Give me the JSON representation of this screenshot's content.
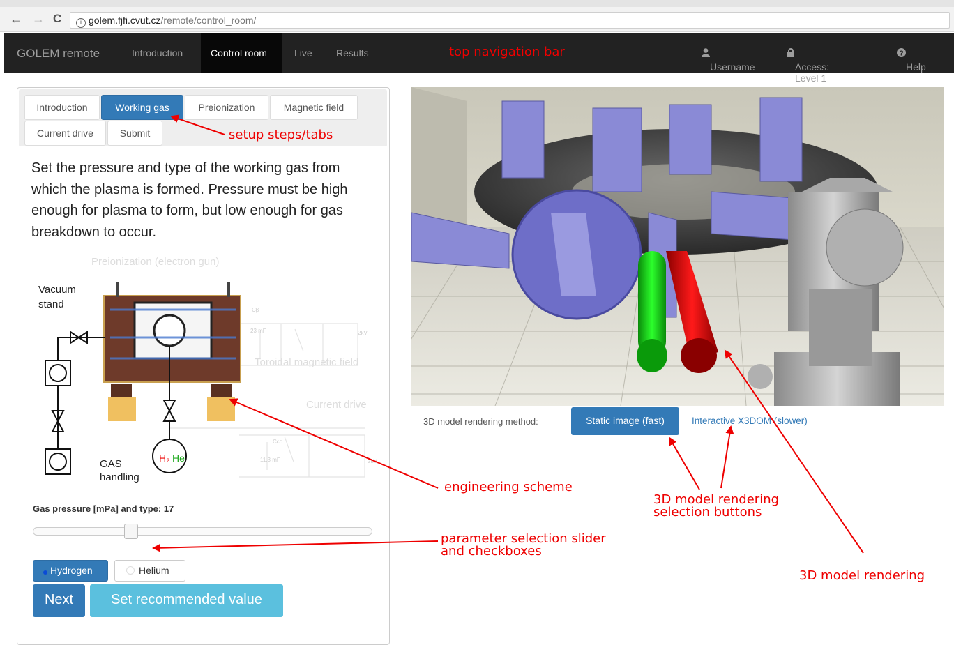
{
  "browser": {
    "back_glyph": "←",
    "forward_glyph": "→",
    "reload_glyph": "C",
    "url_host": "golem.fjfi.cvut.cz",
    "url_path": "/remote/control_room/"
  },
  "navbar": {
    "brand": "GOLEM remote",
    "items": [
      {
        "label": "Introduction",
        "active": false
      },
      {
        "label": "Control room",
        "active": true
      },
      {
        "label": "Live",
        "active": false
      },
      {
        "label": "Results",
        "active": false
      }
    ],
    "username": "Username",
    "access": "Access: Level 1",
    "help": "Help"
  },
  "steps": {
    "tabs": [
      {
        "label": "Introduction",
        "active": false
      },
      {
        "label": "Working gas",
        "active": true
      },
      {
        "label": "Preionization",
        "active": false
      },
      {
        "label": "Magnetic field",
        "active": false
      },
      {
        "label": "Current drive",
        "active": false
      },
      {
        "label": "Submit",
        "active": false
      }
    ],
    "instruction": "Set the pressure and type of the working gas from which the plasma is formed. Pressure must be high enough for plasma to form, but low enough for gas breakdown to occur."
  },
  "scheme": {
    "preionization": "Preionization (electron gun)",
    "vacuum_stand": [
      "Vacuum",
      "stand"
    ],
    "toroidal": "Toroidal magnetic field",
    "current_drive": "Current drive",
    "gas_handling": [
      "GAS",
      "handling"
    ],
    "cap1": "Cβ",
    "cap1_val": "23 mF",
    "cap2": "Cᴄᴅ",
    "cap2_val": "11.3 mF",
    "v1": "2kV",
    "v2": "2kV",
    "h2": "H₂",
    "he": "He"
  },
  "gas": {
    "label": "Gas pressure [mPa] and type: 17",
    "pressure_fraction": 0.28,
    "options": [
      {
        "label": "Hydrogen",
        "selected": true
      },
      {
        "label": "Helium",
        "selected": false
      }
    ],
    "next_label": "Next",
    "recommend_label": "Set recommended value"
  },
  "render_method": {
    "label": "3D model rendering method:",
    "static_label": "Static image (fast)",
    "x3d_label": "Interactive X3DOM (slower)"
  },
  "annotations": {
    "top_nav": "top navigation bar",
    "tabs": "setup steps/tabs",
    "scheme": "engineering scheme",
    "slider_1": "parameter selection slider",
    "slider_2": "and checkboxes",
    "buttons_1": "3D model rendering",
    "buttons_2": "selection buttons",
    "render": "3D model rendering"
  },
  "colors": {
    "accent": "#337ab7",
    "navbar": "#222222",
    "annotation": "#ee0000",
    "recommend": "#5bc0de"
  }
}
